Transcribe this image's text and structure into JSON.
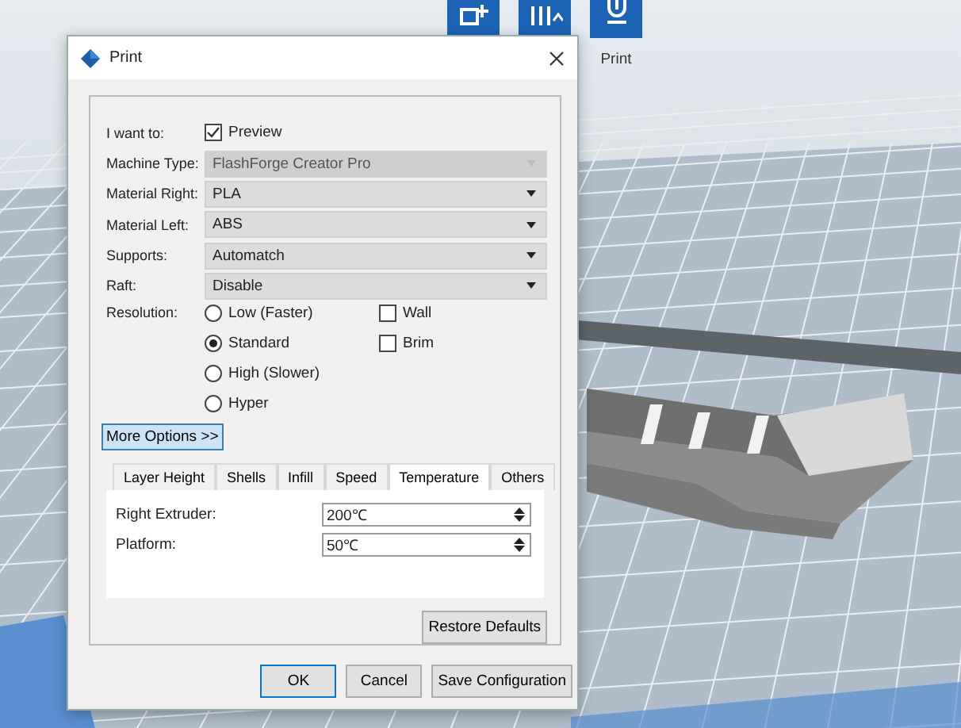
{
  "toolbar": {
    "items": [
      {
        "kind": "add"
      },
      {
        "kind": "tools"
      },
      {
        "kind": "print",
        "label": "Print"
      }
    ]
  },
  "dialog": {
    "title": "Print",
    "preview": {
      "label": "I want to:",
      "option": "Preview",
      "checked": true
    },
    "selects": [
      {
        "label": "Machine Type:",
        "value": "FlashForge Creator Pro",
        "disabled": true
      },
      {
        "label": "Material Right:",
        "value": "PLA",
        "disabled": false
      },
      {
        "label": "Material Left:",
        "value": "ABS",
        "disabled": false
      },
      {
        "label": "Supports:",
        "value": "Automatch",
        "disabled": false
      },
      {
        "label": "Raft:",
        "value": "Disable",
        "disabled": false
      }
    ],
    "resolution": {
      "label": "Resolution:",
      "options": [
        {
          "label": "Low (Faster)",
          "selected": false
        },
        {
          "label": "Standard",
          "selected": true
        },
        {
          "label": "High (Slower)",
          "selected": false
        },
        {
          "label": "Hyper",
          "selected": false
        }
      ]
    },
    "extras": [
      {
        "label": "Wall",
        "checked": false
      },
      {
        "label": "Brim",
        "checked": false
      }
    ],
    "more_options": "More Options >>",
    "tabs": [
      {
        "label": "Layer Height",
        "selected": false
      },
      {
        "label": "Shells",
        "selected": false
      },
      {
        "label": "Infill",
        "selected": false
      },
      {
        "label": "Speed",
        "selected": false
      },
      {
        "label": "Temperature",
        "selected": true
      },
      {
        "label": "Others",
        "selected": false
      }
    ],
    "fields": [
      {
        "label": "Right Extruder:",
        "value": "200℃"
      },
      {
        "label": "Platform:",
        "value": "50℃"
      }
    ],
    "restore": "Restore Defaults",
    "buttons": [
      "OK",
      "Cancel",
      "Save Configuration"
    ]
  }
}
